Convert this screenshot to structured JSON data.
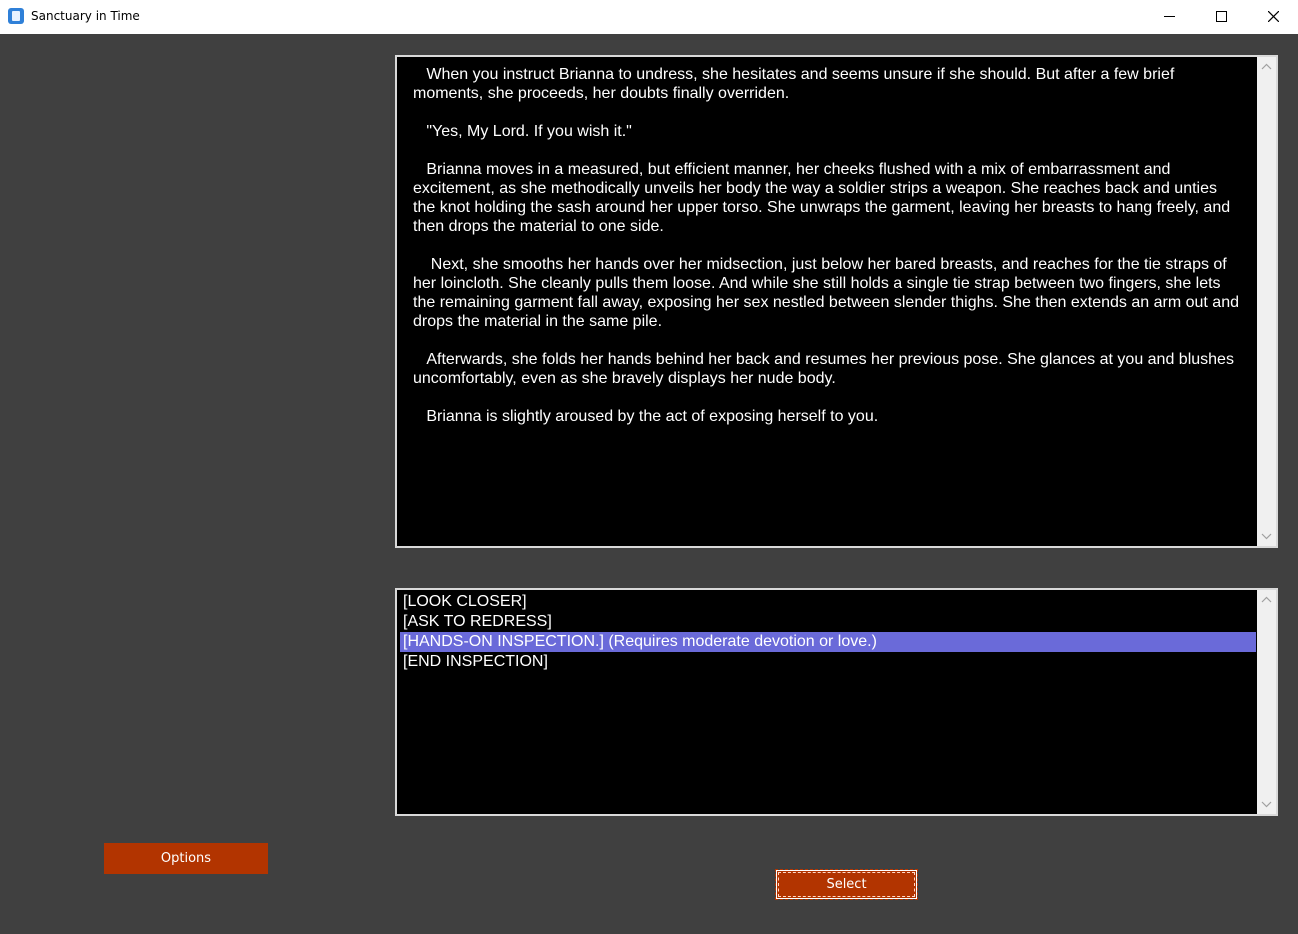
{
  "window": {
    "title": "Sanctuary in Time",
    "controls": [
      "minimize-icon",
      "maximize-icon",
      "close-icon"
    ]
  },
  "story": {
    "paragraphs": [
      "   When you instruct Brianna to undress, she hesitates and seems unsure if she should. But after a few brief moments, she proceeds, her doubts finally overriden.",
      "   \"Yes, My Lord. If you wish it.\"",
      "   Brianna moves in a measured, but efficient manner, her cheeks flushed with a mix of embarrassment and excitement, as she methodically unveils her body the way a soldier strips a weapon. She reaches back and unties the knot holding the sash around her upper torso. She unwraps the garment, leaving her breasts to hang freely, and then drops the material to one side.",
      "    Next, she smooths her hands over her midsection, just below her bared breasts, and reaches for the tie straps of her loincloth. She cleanly pulls them loose. And while she still holds a single tie strap between two fingers, she lets the remaining garment fall away, exposing her sex nestled between slender thighs. She then extends an arm out and drops the material in the same pile.",
      "   Afterwards, she folds her hands behind her back and resumes her previous pose. She glances at you and blushes uncomfortably, even as she bravely displays her nude body.",
      "   Brianna is slightly aroused by the act of exposing herself to you."
    ]
  },
  "choices": {
    "items": [
      "[LOOK CLOSER]",
      "[ASK TO REDRESS]",
      "[HANDS-ON INSPECTION.] (Requires moderate devotion or love.)",
      "[END INSPECTION]"
    ],
    "selected_index": 2
  },
  "buttons": {
    "options_label": "Options",
    "select_label": "Select"
  },
  "colors": {
    "background": "#404040",
    "panel": "#000000",
    "button": "#b23400",
    "selection": "#6a6ad9"
  }
}
